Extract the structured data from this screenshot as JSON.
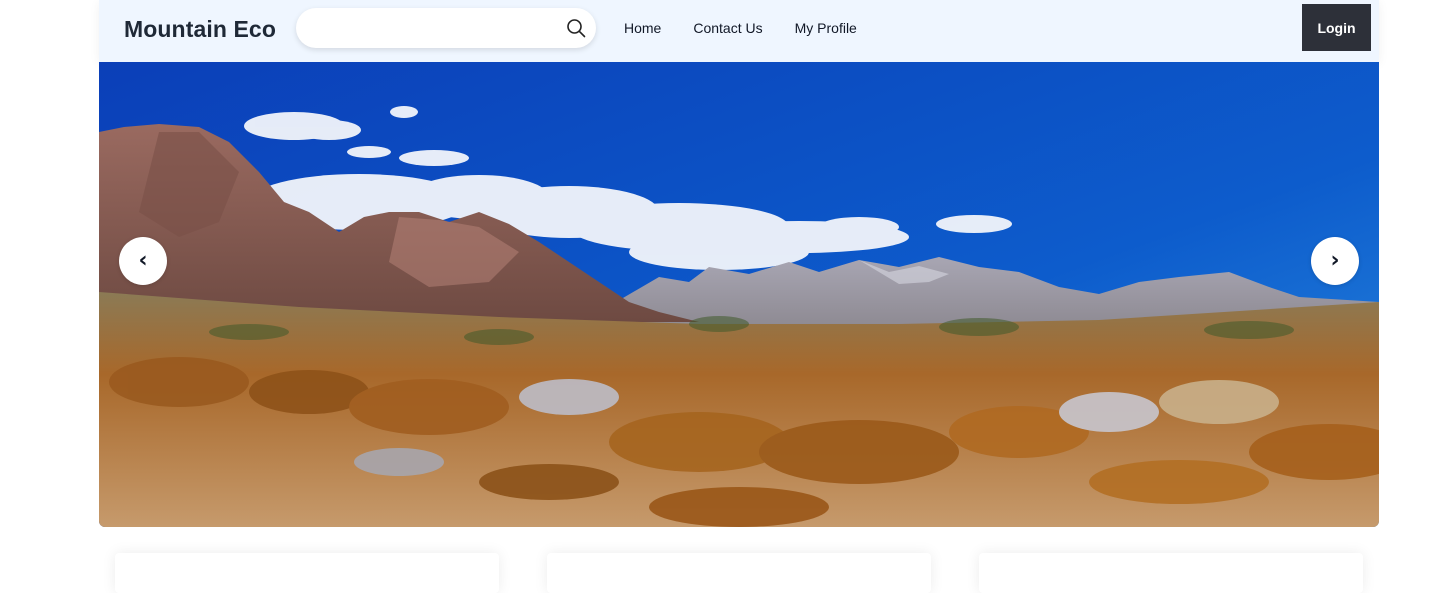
{
  "header": {
    "brand": "Mountain Eco",
    "search": {
      "value": "",
      "placeholder": "",
      "icon": "search-icon"
    },
    "nav": [
      {
        "label": "Home"
      },
      {
        "label": "Contact Us"
      },
      {
        "label": "My Profile"
      }
    ],
    "login_label": "Login"
  },
  "carousel": {
    "prev_label": "‹",
    "next_label": "›",
    "image": "desert-mountain-landscape"
  },
  "colors": {
    "header_bg": "#eff6ff",
    "login_bg": "#2d3039",
    "sky_top": "#0b3fb8",
    "sky_bottom": "#1e7ad6"
  }
}
